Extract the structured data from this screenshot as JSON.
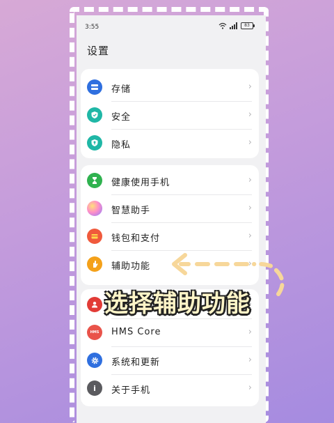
{
  "status_bar": {
    "time": "3:55",
    "battery": "83"
  },
  "page_title": "设置",
  "groups": [
    {
      "items": [
        {
          "label": "存储",
          "icon": "storage-icon",
          "color": "#2f6fdf"
        },
        {
          "label": "安全",
          "icon": "shield-icon",
          "color": "#1fb7a6"
        },
        {
          "label": "隐私",
          "icon": "privacy-icon",
          "color": "#1fb7a6"
        }
      ]
    },
    {
      "items": [
        {
          "label": "健康使用手机",
          "icon": "hourglass-icon",
          "color": "#2fb24f"
        },
        {
          "label": "智慧助手",
          "icon": "assistant-orb-icon",
          "color": "#e98ad6"
        },
        {
          "label": "钱包和支付",
          "icon": "wallet-icon",
          "color": "#f05a3c"
        },
        {
          "label": "辅助功能",
          "icon": "accessibility-hand-icon",
          "color": "#f4a11a"
        }
      ]
    },
    {
      "items": [
        {
          "label": "",
          "icon": "account-icon",
          "color": "#e23b36"
        },
        {
          "label": "HMS Core",
          "icon": "hms-icon",
          "icon_text": "HMS",
          "color": "#e9534a"
        },
        {
          "label": "系统和更新",
          "icon": "gear-icon",
          "color": "#2f6fdf"
        },
        {
          "label": "关于手机",
          "icon": "info-icon",
          "color": "#5b5b5f"
        }
      ]
    }
  ],
  "caption": "选择辅助功能",
  "colors": {
    "caption": "#fff5c8",
    "arrow": "#f7d79a",
    "frame": "#ffffff"
  }
}
